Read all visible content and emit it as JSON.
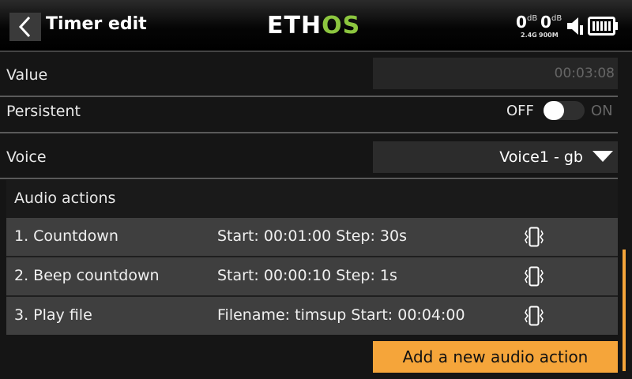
{
  "header": {
    "title": "Timer edit",
    "logo_white": "ETH",
    "logo_green": "OS",
    "rssi_24": {
      "value": "0",
      "unit": "dB",
      "band": "2.4G"
    },
    "rssi_900": {
      "value": "0",
      "unit": "dB",
      "band": "900M"
    },
    "icons": {
      "back": "chevron-left-icon",
      "speaker": "speaker-icon",
      "battery": "battery-icon"
    }
  },
  "fields": {
    "value": {
      "label": "Value",
      "value": "00:03:08"
    },
    "persistent": {
      "label": "Persistent",
      "off_label": "OFF",
      "on_label": "ON",
      "state": "off"
    },
    "voice": {
      "label": "Voice",
      "value": "Voice1 - gb"
    }
  },
  "audio_actions": {
    "title": "Audio actions",
    "items": [
      {
        "name": "1. Countdown",
        "detail": "Start: 00:01:00 Step: 30s",
        "icon": "vibrate-icon"
      },
      {
        "name": "2. Beep countdown",
        "detail": "Start: 00:00:10 Step: 1s",
        "icon": "vibrate-icon"
      },
      {
        "name": "3. Play file",
        "detail": "Filename: timsup Start: 00:04:00",
        "icon": "vibrate-icon"
      }
    ],
    "add_label": "Add a new audio action"
  },
  "colors": {
    "accent": "#f5a53a",
    "logo_green": "#8cc63f",
    "background": "#151515"
  }
}
